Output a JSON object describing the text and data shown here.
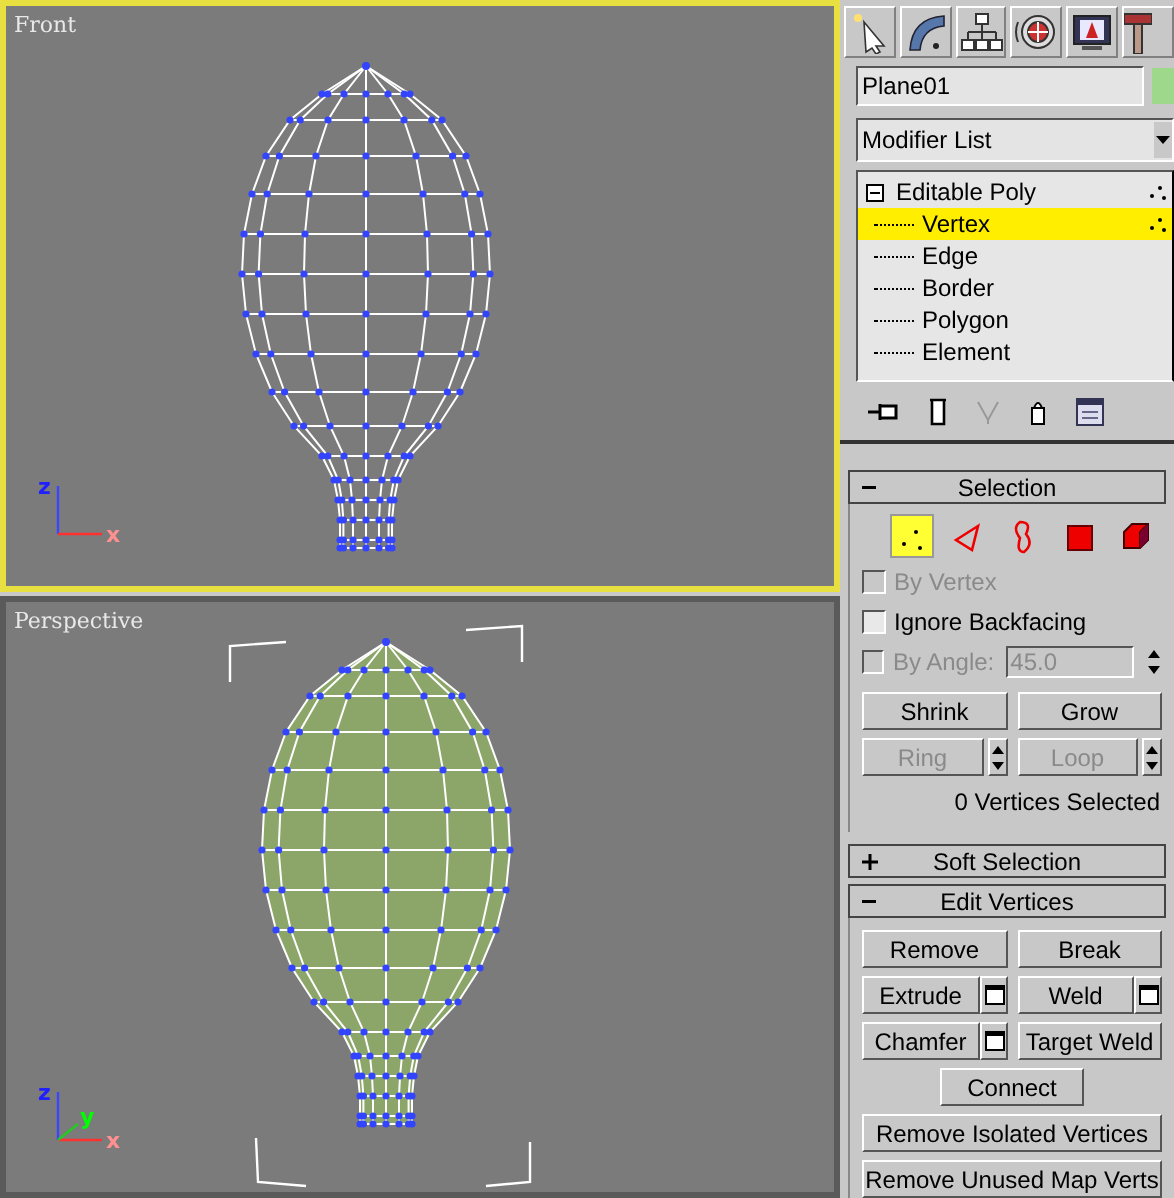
{
  "viewports": [
    {
      "label": "Front",
      "active": true,
      "kind": "front",
      "axes": [
        {
          "label": "z"
        },
        {
          "label": "x"
        }
      ]
    },
    {
      "label": "Perspective",
      "active": false,
      "kind": "perspective",
      "axes": [
        {
          "label": "z"
        },
        {
          "label": "x"
        },
        {
          "label": "y"
        }
      ]
    }
  ],
  "object_name": "Plane01",
  "modifier_list": "Modifier List",
  "stack": [
    {
      "label": "Editable Poly",
      "expanded": true,
      "children": [
        {
          "label": "Vertex",
          "selected": true
        },
        {
          "label": "Edge",
          "selected": false
        },
        {
          "label": "Border",
          "selected": false
        },
        {
          "label": "Polygon",
          "selected": false
        },
        {
          "label": "Element",
          "selected": false
        }
      ]
    }
  ],
  "selection": {
    "title": "Selection",
    "expanded": true,
    "levels": [
      {
        "kind": "vertex",
        "selected": true
      },
      {
        "kind": "edge",
        "selected": false
      },
      {
        "kind": "border",
        "selected": false
      },
      {
        "kind": "polygon",
        "selected": false
      },
      {
        "kind": "element",
        "selected": false
      }
    ],
    "checkboxes": [
      {
        "label": "By Vertex",
        "checked": false,
        "disabled": true
      },
      {
        "label": "Ignore Backfacing",
        "checked": false,
        "disabled": false
      },
      {
        "label": "By Angle:",
        "checked": false,
        "disabled": true,
        "value": "45.0"
      }
    ],
    "buttons": [
      {
        "label": "Shrink",
        "disabled": false,
        "spinner": false
      },
      {
        "label": "Grow",
        "disabled": false,
        "spinner": false
      },
      {
        "label": "Ring",
        "disabled": true,
        "spinner": true
      },
      {
        "label": "Loop",
        "disabled": true,
        "spinner": true
      }
    ],
    "status": "0 Vertices Selected"
  },
  "soft_selection": {
    "title": "Soft Selection",
    "expanded": false
  },
  "edit_vertices": {
    "title": "Edit Vertices",
    "expanded": true,
    "buttons": [
      {
        "label": "Remove",
        "kind": "half",
        "settings": false
      },
      {
        "label": "Break",
        "kind": "half",
        "settings": false
      },
      {
        "label": "Extrude",
        "kind": "half",
        "settings": true
      },
      {
        "label": "Weld",
        "kind": "half",
        "settings": true
      },
      {
        "label": "Chamfer",
        "kind": "half",
        "settings": true
      },
      {
        "label": "Target Weld",
        "kind": "half",
        "settings": false
      },
      {
        "label": "Connect",
        "kind": "center",
        "settings": false
      },
      {
        "label": "Remove Isolated Vertices",
        "kind": "full",
        "settings": false
      },
      {
        "label": "Remove Unused Map Verts",
        "kind": "full",
        "settings": false
      }
    ]
  }
}
